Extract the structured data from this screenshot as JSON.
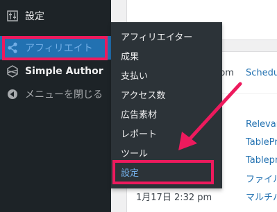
{
  "sidebar": {
    "items": [
      {
        "label": "設定"
      },
      {
        "label": "アフィリエイト"
      },
      {
        "label": "Simple Author"
      },
      {
        "label": "メニューを閉じる"
      }
    ]
  },
  "flyout": {
    "items": [
      {
        "label": "アフィリエイター"
      },
      {
        "label": "成果"
      },
      {
        "label": "支払い"
      },
      {
        "label": "アクセス数"
      },
      {
        "label": "広告素材"
      },
      {
        "label": "レポート"
      },
      {
        "label": "ツール"
      },
      {
        "label": "設定"
      }
    ]
  },
  "content": {
    "row1_time": "pm",
    "row1_link": "Schedu",
    "links": [
      "Relevan",
      "TablePr",
      "Tablepr",
      "ファイル",
      "マルチパ"
    ],
    "last_time": "1月17日 2:32 pm"
  },
  "colors": {
    "sidebar_bg": "#1d2327",
    "flyout_bg": "#2c3338",
    "active_bg": "#2271b1",
    "active_text": "#72aee6",
    "annotation": "#ed1a5d"
  },
  "icons": {
    "settings": "sliders-icon",
    "affiliate": "share-nodes-icon",
    "simple_author": "cube-icon",
    "collapse": "collapse-arrow-icon"
  }
}
